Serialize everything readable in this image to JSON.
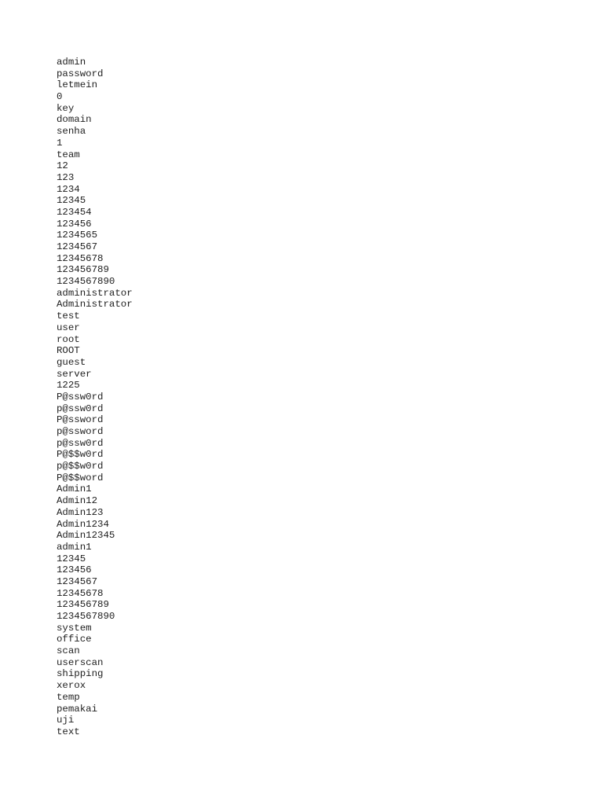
{
  "document": {
    "lines": [
      "admin",
      "password",
      "letmein",
      "0",
      "key",
      "domain",
      "senha",
      "1",
      "team",
      "12",
      "123",
      "1234",
      "12345",
      "123454",
      "123456",
      "1234565",
      "1234567",
      "12345678",
      "123456789",
      "1234567890",
      "administrator",
      "Administrator",
      "test",
      "user",
      "root",
      "ROOT",
      "guest",
      "server",
      "1225",
      "P@ssw0rd",
      "p@ssw0rd",
      "P@ssword",
      "p@ssword",
      "p@ssw0rd",
      "P@$$w0rd",
      "p@$$w0rd",
      "P@$$word",
      "Admin1",
      "Admin12",
      "Admin123",
      "Admin1234",
      "Admin12345",
      "admin1",
      "12345",
      "123456",
      "1234567",
      "12345678",
      "123456789",
      "1234567890",
      "system",
      "office",
      "scan",
      "userscan",
      "shipping",
      "xerox",
      "temp",
      "pemakai",
      "uji",
      "text"
    ]
  }
}
